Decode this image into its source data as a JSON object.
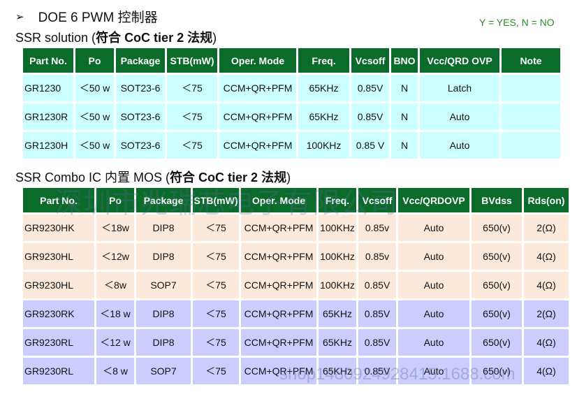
{
  "heading": {
    "bullet": "➢",
    "title": "DOE 6 PWM 控制器"
  },
  "legend": "Y = YES, N = NO",
  "section1": {
    "prefix": "SSR solution (",
    "bold": "符合 CoC tier 2 法规",
    "suffix": ")",
    "headers": [
      "Part No.",
      "Po",
      "Package",
      "STB(mW)",
      "Oper. Mode",
      "Freq.",
      "Vcsoff",
      "BNO",
      "Vcc/QRD OVP",
      "Note"
    ],
    "rows": [
      [
        "GR1230",
        "＜50 w",
        "SOT23-6",
        "＜75",
        "CCM+QR+PFM",
        "65KHz",
        "0.85V",
        "N",
        "Latch",
        ""
      ],
      [
        "GR1230R",
        "＜50 w",
        "SOT23-6",
        "＜75",
        "CCM+QR+PFM",
        "65KHz",
        "0.85V",
        "N",
        "Auto",
        ""
      ],
      [
        "GR1230H",
        "＜50 w",
        "SOT23-6",
        "＜75",
        "CCM+QR+PFM",
        "100KHz",
        "0.85 V",
        "N",
        "Auto",
        ""
      ]
    ]
  },
  "section2": {
    "prefix": "SSR Combo IC 内置 MOS (",
    "bold": "符合 CoC tier 2 法规",
    "suffix": ")",
    "headers": [
      "Part No.",
      "Po",
      "Package",
      "STB(mW)",
      "Oper. Mode",
      "Freq.",
      "Vcsoff",
      "Vcc/QRDOVP",
      "BVdss",
      "Rds(on)"
    ],
    "rows": [
      [
        "GR9230HK",
        "＜18w",
        "DIP8",
        "＜75",
        "CCM+QR+PFM",
        "100KHz",
        "0.85v",
        "Auto",
        "650(v)",
        "2(Ω)"
      ],
      [
        "GR9230HL",
        "＜12w",
        "DIP8",
        "＜75",
        "CCM+QR+PFM",
        "100KHz",
        "0.85v",
        "Auto",
        "650(v)",
        "4(Ω)"
      ],
      [
        "GR9230HL",
        "＜8w",
        "SOP7",
        "＜75",
        "CCM+QR+PFM",
        "100KHz",
        "0.85V",
        "Auto",
        "650(v)",
        "4(Ω)"
      ],
      [
        "GR9230RK",
        "＜18 w",
        "DIP8",
        "＜75",
        "CCM+QR+PFM",
        "65KHz",
        "0.85V",
        "Auto",
        "650(v)",
        "2(Ω)"
      ],
      [
        "GR9230RL",
        "＜12 w",
        "DIP8",
        "＜75",
        "CCM+QR+PFM",
        "65KHz",
        "0.85V",
        "Auto",
        "650(v)",
        "4(Ω)"
      ],
      [
        "GR9230RL",
        "＜8 w",
        "SOP7",
        "＜75",
        "CCM+QR+PFM",
        "65KHz",
        "0.85V",
        "Auto",
        "650(v)",
        "4(Ω)"
      ]
    ]
  },
  "watermark": {
    "company": "深圳市兆瑞芯电子有限公司",
    "site": "shop1480924928415.1688.com"
  }
}
